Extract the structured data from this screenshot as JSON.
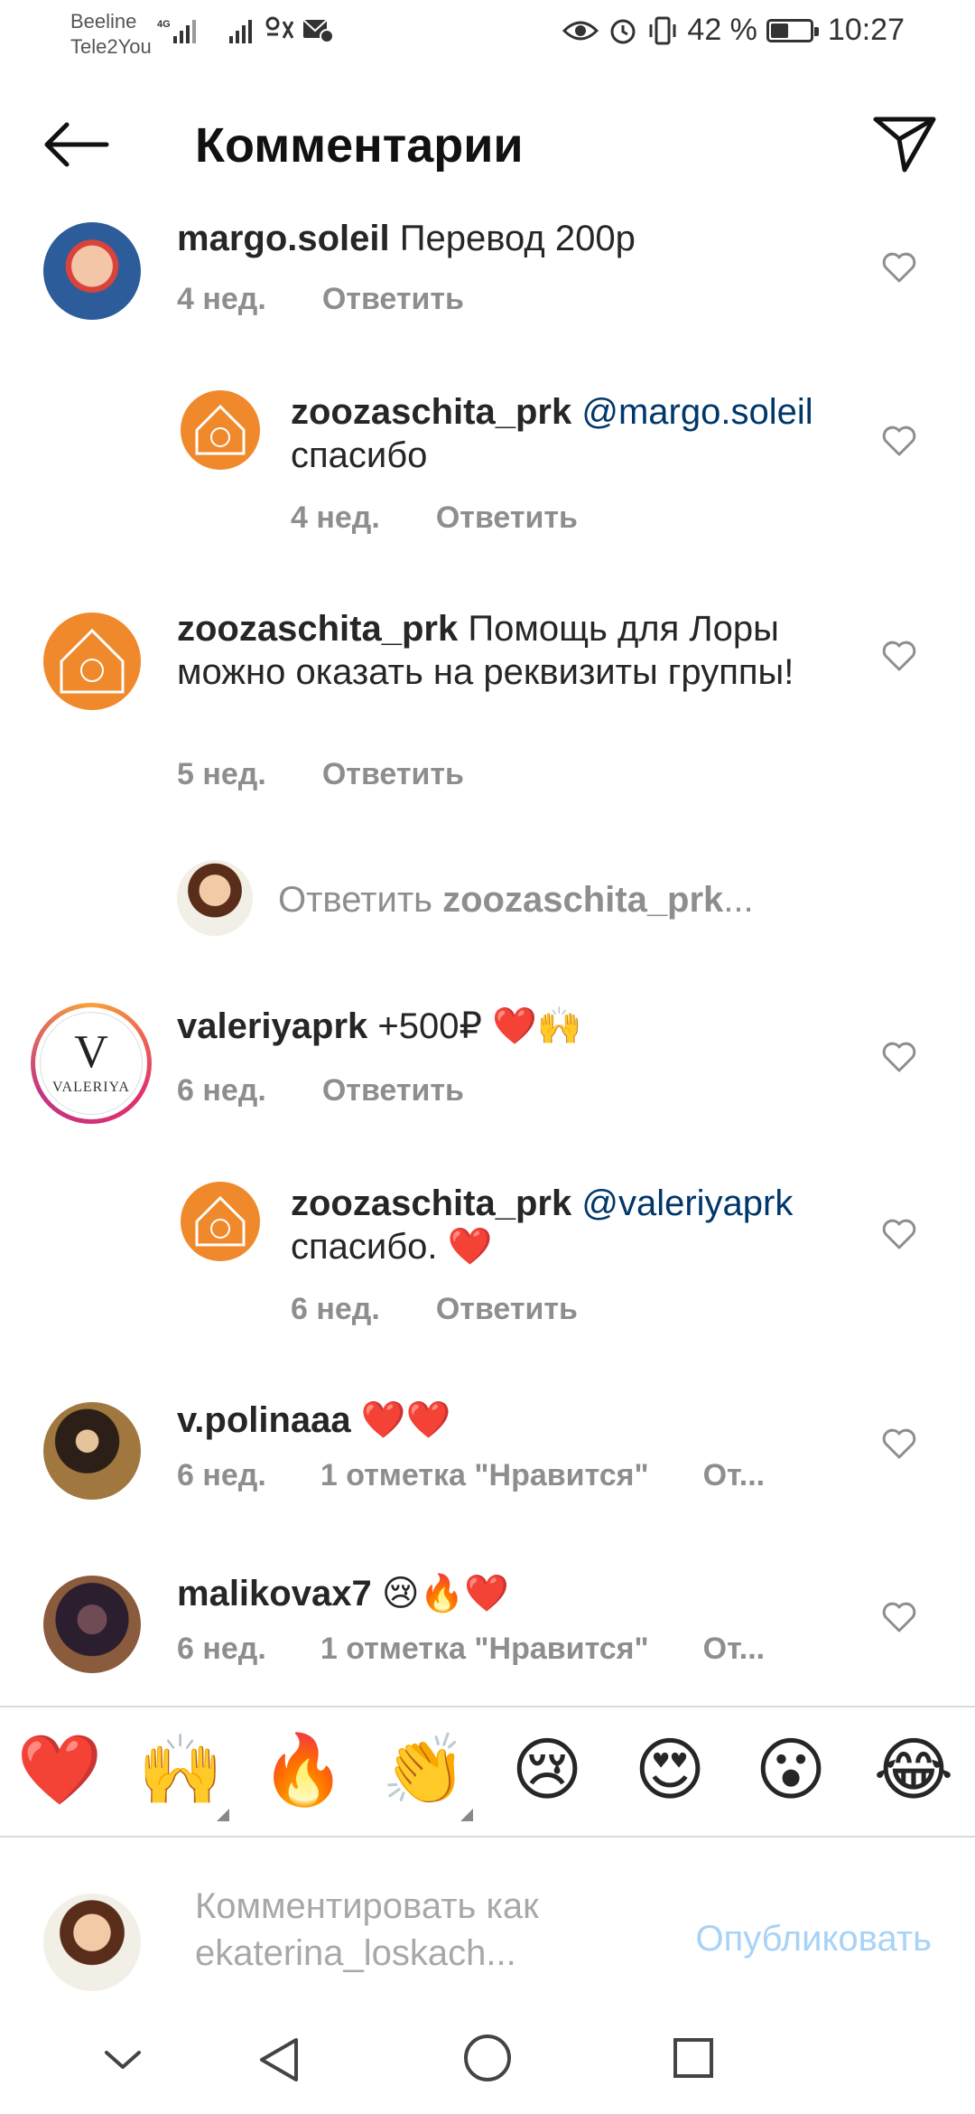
{
  "status_bar": {
    "carrier1": "Beeline",
    "carrier2": "Tele2You",
    "network": "4G",
    "battery_percent": "42 %",
    "battery_level": 0.42,
    "time": "10:27"
  },
  "header": {
    "title": "Комментарии",
    "back_icon": "arrow-left-icon",
    "send_icon": "paper-plane-icon"
  },
  "comments": [
    {
      "username": "margo.soleil",
      "mention": "",
      "text": "Перевод 200р",
      "time": "4 нед.",
      "likes": "",
      "reply_label": "Ответить",
      "avatar_color": "#3a6ea5"
    },
    {
      "username": "zoozaschita_prk",
      "mention": "@margo.soleil",
      "text": "спасибо",
      "time": "4 нед.",
      "likes": "",
      "reply_label": "Ответить",
      "avatar_color": "#f0892b"
    },
    {
      "username": "zoozaschita_prk",
      "mention": "",
      "text": "Помощь для Лоры можно оказать на реквизиты группы!",
      "time": "5 нед.",
      "likes": "",
      "reply_label": "Ответить",
      "avatar_color": "#f0892b"
    },
    {
      "username": "valeriyaprk",
      "mention": "",
      "text": "+500₽ ❤️🙌",
      "time": "6 нед.",
      "likes": "",
      "reply_label": "Ответить",
      "avatar_color": "#ffffff"
    },
    {
      "username": "zoozaschita_prk",
      "mention": "@valeriyaprk",
      "text": "спасибо. ❤️",
      "time": "6 нед.",
      "likes": "",
      "reply_label": "Ответить",
      "avatar_color": "#f0892b"
    },
    {
      "username": "v.polinaaa",
      "mention": "",
      "text": "❤️❤️",
      "time": "6 нед.",
      "likes": "1 отметка \"Нравится\"",
      "reply_label": "От...",
      "avatar_color": "#7a5a3a"
    },
    {
      "username": "malikovax7",
      "mention": "",
      "text": "😢🔥❤️",
      "time": "6 нед.",
      "likes": "1 отметка \"Нравится\"",
      "reply_label": "От...",
      "avatar_color": "#3b2a33"
    }
  ],
  "reply_field": {
    "prefix": "Ответить ",
    "target": "zoozaschita_prk",
    "ellipsis": "..."
  },
  "valeriya_logo": {
    "letter": "V",
    "name": "VALERIYA"
  },
  "emoji_bar": [
    "❤️",
    "🙌",
    "🔥",
    "👏",
    "😢",
    "😍",
    "😮",
    "😂"
  ],
  "composer": {
    "placeholder": "Комментировать как ekaterina_loskach...",
    "publish_label": "Опубликовать"
  },
  "nav": {
    "collapse_icon": "chevron-down-icon",
    "back_icon": "triangle-back-icon",
    "home_icon": "circle-home-icon",
    "recents_icon": "square-recents-icon"
  }
}
